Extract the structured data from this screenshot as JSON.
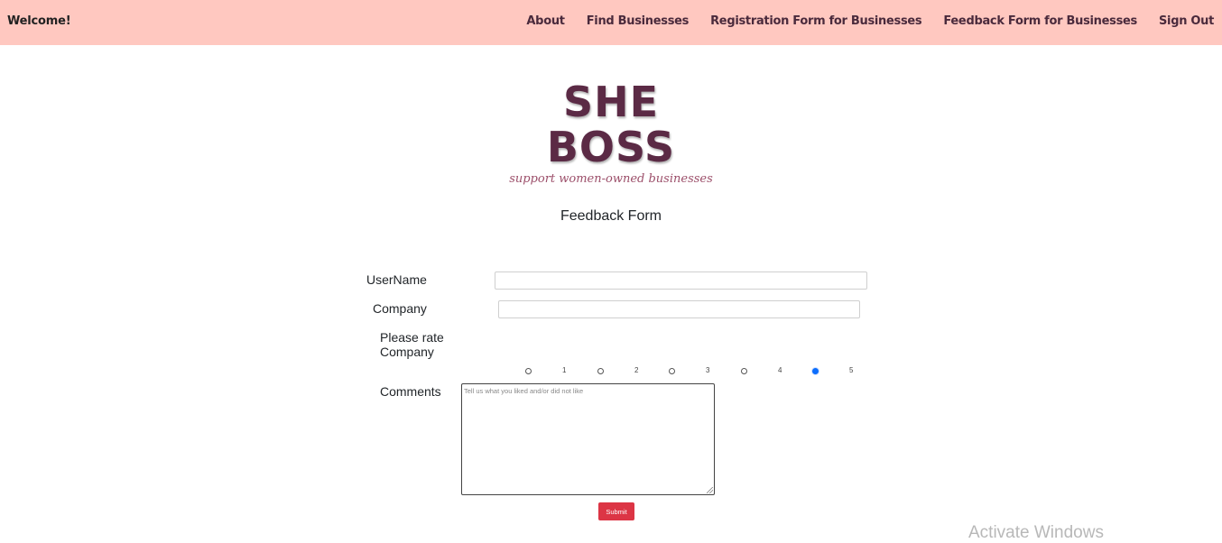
{
  "navbar": {
    "brand": "Welcome!",
    "links": [
      {
        "label": "About"
      },
      {
        "label": "Find Businesses"
      },
      {
        "label": "Registration Form for Businesses"
      },
      {
        "label": "Feedback Form for Businesses"
      },
      {
        "label": "Sign Out"
      }
    ]
  },
  "logo": {
    "line1": "SHE",
    "line2": "BOSS",
    "tagline": "support women-owned businesses"
  },
  "form": {
    "title": "Feedback Form",
    "username_label": "UserName",
    "username_value": "",
    "company_label": "Company",
    "company_value": "",
    "rating_label_line1": "Please rate",
    "rating_label_line2": "Company",
    "rating_options": [
      "1",
      "2",
      "3",
      "4",
      "5"
    ],
    "rating_selected": "5",
    "comments_label": "Comments",
    "comments_placeholder": "Tell us what you liked and/or did not like",
    "submit_label": "Submit"
  },
  "system": {
    "watermark": "Activate Windows"
  },
  "colors": {
    "navbar_bg": "#ffc8c0",
    "logo": "#5b2a45",
    "tagline": "#9c4f6a",
    "submit_bg": "#dc3545",
    "radio_checked": "#0d6efd"
  }
}
